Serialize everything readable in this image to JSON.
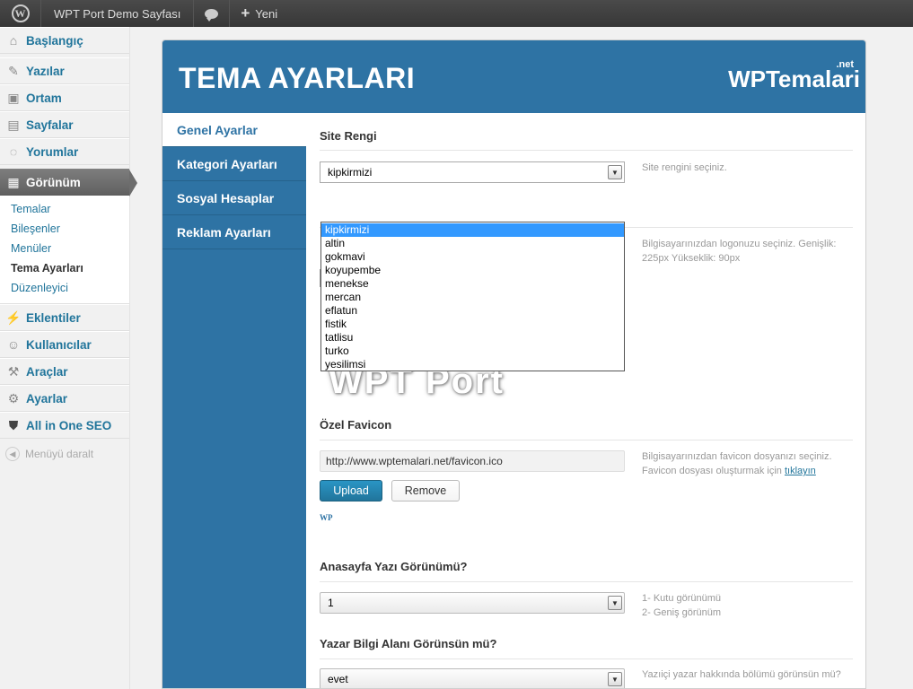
{
  "adminbar": {
    "site_name": "WPT Port Demo Sayfası",
    "new_label": "Yeni"
  },
  "menu": {
    "dashboard": "Başlangıç",
    "posts": "Yazılar",
    "media": "Ortam",
    "pages": "Sayfalar",
    "comments": "Yorumlar",
    "appearance": "Görünüm",
    "appearance_sub": [
      "Temalar",
      "Bileşenler",
      "Menüler",
      "Tema Ayarları",
      "Düzenleyici"
    ],
    "plugins": "Eklentiler",
    "users": "Kullanıcılar",
    "tools": "Araçlar",
    "settings": "Ayarlar",
    "seo": "All in One SEO",
    "collapse": "Menüyü daralt"
  },
  "panel": {
    "title": "TEMA AYARLARI",
    "brand": "WPTemalari",
    "brand_suffix": ".net",
    "tabs": [
      "Genel Ayarlar",
      "Kategori Ayarları",
      "Sosyal Hesaplar",
      "Reklam Ayarları"
    ]
  },
  "site_color": {
    "title": "Site Rengi",
    "selected": "kipkirmizi",
    "help": "Site rengini seçiniz.",
    "options": [
      "kipkirmizi",
      "altin",
      "gokmavi",
      "koyupembe",
      "menekse",
      "mercan",
      "eflatun",
      "fistik",
      "tatlisu",
      "turko",
      "yesilimsi"
    ]
  },
  "logo": {
    "help": "Bilgisayarınızdan logonuzu seçiniz. Genişlik: 225px Yükseklik: 90px",
    "preview_text": "WPT Port"
  },
  "favicon": {
    "title": "Özel Favicon",
    "url": "http://www.wptemalari.net/favicon.ico",
    "help_line1": "Bilgisayarınızdan favicon dosyanızı seçiniz.",
    "help_line2": "Favicon dosyası oluşturmak için ",
    "help_link": "tıklayın",
    "upload_label": "Upload",
    "remove_label": "Remove",
    "preview_text": "WP"
  },
  "homepage_view": {
    "title": "Anasayfa Yazı Görünümü?",
    "selected": "1",
    "help_line1": "1- Kutu görünümü",
    "help_line2": "2- Geniş görünüm"
  },
  "author_box": {
    "title": "Yazar Bilgi Alanı Görünsün mü?",
    "selected": "evet",
    "help": "Yazıiçi yazar hakkında bölümü görünsün mü?"
  }
}
